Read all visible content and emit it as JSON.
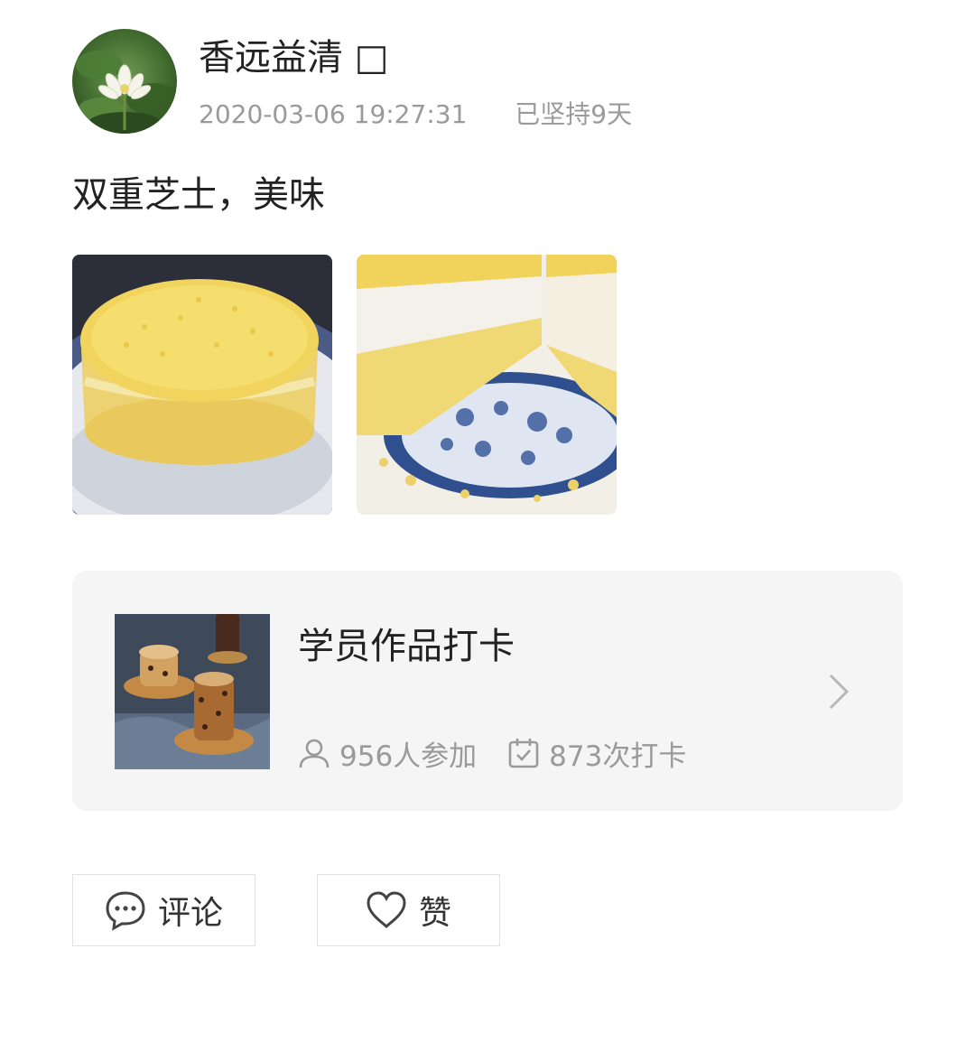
{
  "post": {
    "author": {
      "name": "香远益清 □"
    },
    "timestamp": "2020-03-06 19:27:31",
    "streak": "已坚持9天",
    "text": "双重芝士，美味",
    "photos": [
      {
        "subject": "double-cheese-cake-whole"
      },
      {
        "subject": "double-cheese-cake-slice"
      }
    ]
  },
  "checkin_card": {
    "title": "学员作品打卡",
    "participants": "956人参加",
    "checkins": "873次打卡",
    "icons": [
      "user-icon",
      "calendar-check-icon",
      "chevron-right-icon"
    ]
  },
  "actions": {
    "comment_label": "评论",
    "like_label": "赞",
    "icons": [
      "comment-bubble-icon",
      "heart-icon"
    ]
  },
  "colors": {
    "text_primary": "#222222",
    "text_secondary": "#9a9a9a",
    "card_bg": "#f5f5f5",
    "border": "#e2e2e2"
  }
}
